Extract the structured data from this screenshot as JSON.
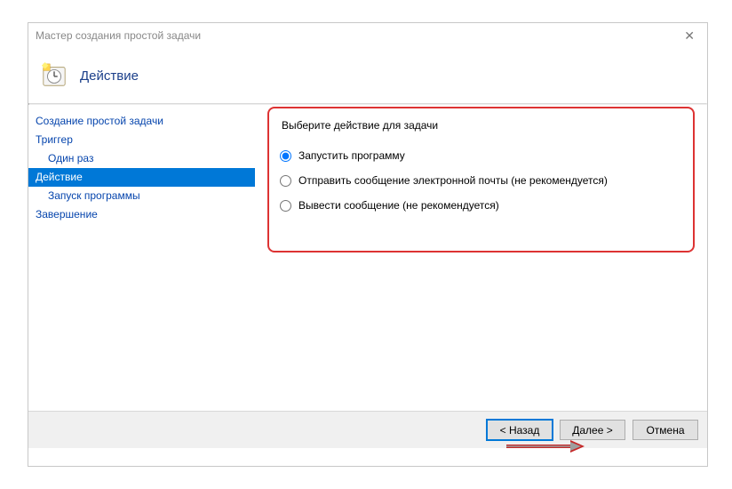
{
  "window": {
    "title": "Мастер создания простой задачи"
  },
  "header": {
    "title": "Действие"
  },
  "sidebar": {
    "items": [
      {
        "label": "Создание простой задачи",
        "level": 0,
        "selected": false
      },
      {
        "label": "Триггер",
        "level": 0,
        "selected": false
      },
      {
        "label": "Один раз",
        "level": 1,
        "selected": false
      },
      {
        "label": "Действие",
        "level": 0,
        "selected": true
      },
      {
        "label": "Запуск программы",
        "level": 1,
        "selected": false
      },
      {
        "label": "Завершение",
        "level": 0,
        "selected": false
      }
    ]
  },
  "content": {
    "prompt": "Выберите действие для задачи",
    "options": [
      {
        "label": "Запустить программу",
        "checked": true
      },
      {
        "label": "Отправить сообщение электронной почты (не рекомендуется)",
        "checked": false
      },
      {
        "label": "Вывести сообщение (не рекомендуется)",
        "checked": false
      }
    ]
  },
  "buttons": {
    "back": "< Назад",
    "next": "Далее >",
    "cancel": "Отмена"
  }
}
